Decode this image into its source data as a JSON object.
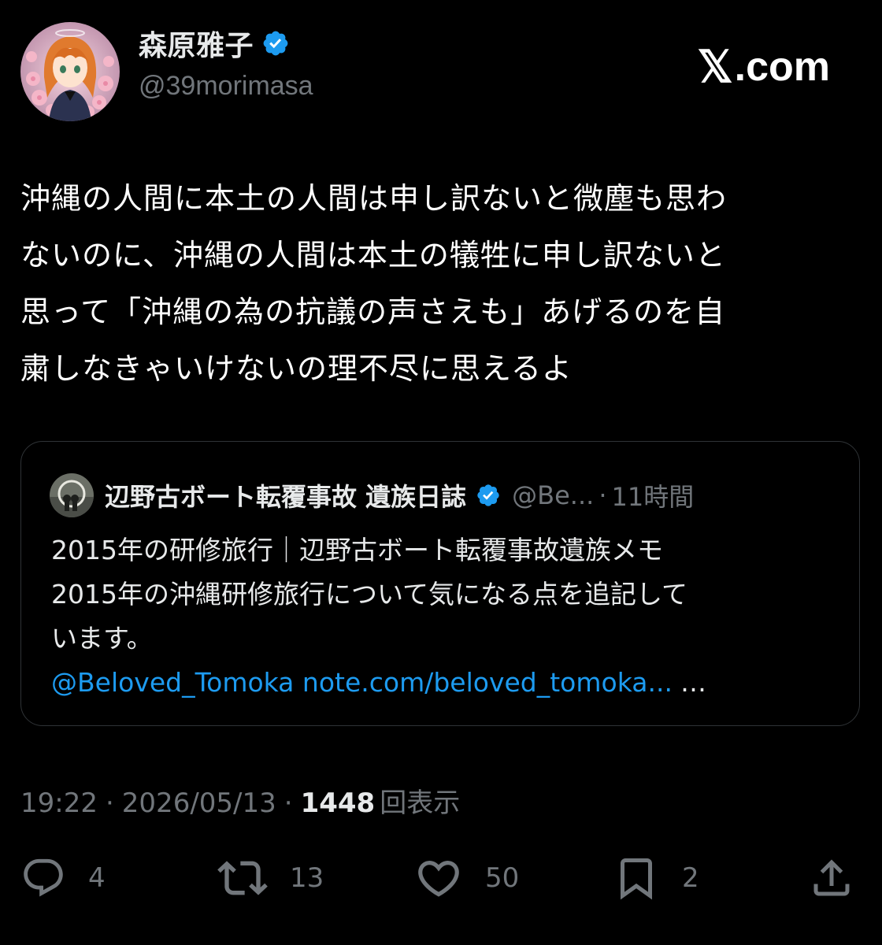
{
  "author": {
    "display_name": "森原雅子",
    "handle": "@39morimasa",
    "verified": true,
    "verified_color": "#1d9bf0",
    "avatar_icon": "avatar-anime-girl-cherry-blossoms"
  },
  "brand": {
    "x_glyph": "𝕏",
    "domain": ".com"
  },
  "tweet": {
    "text": "沖縄の人間に本土の人間は申し訳ないと微塵も思わ\nないのに、沖縄の人間は本土の犠牲に申し訳ないと\n思って「沖縄の為の抗議の声さえも」あげるのを自\n粛しなきゃいけないの理不尽に思えるよ"
  },
  "quote": {
    "name": "辺野古ボート転覆事故 遺族日誌",
    "handle": "@Be...",
    "dot": "·",
    "time": "11時間",
    "lines": [
      "2015年の研修旅行｜辺野古ボート転覆事故遺族メモ",
      "2015年の沖縄研修旅行について気になる点を追記して",
      "います。"
    ],
    "mention": "@Beloved_Tomoka",
    "url": "note.com/beloved_tomoka...",
    "more": "…"
  },
  "meta": {
    "time": "19:22",
    "sep1": "·",
    "date": "2026/05/13",
    "sep2": "·",
    "views_count": "1448",
    "views_label": "回表示"
  },
  "actions": {
    "reply_count": "4",
    "retweet_count": "13",
    "like_count": "50",
    "bookmark_count": "2"
  },
  "colors": {
    "background": "#000000",
    "text": "#e7e9ea",
    "secondary": "#71767b",
    "link": "#1d9bf0",
    "border": "#2f3336"
  }
}
